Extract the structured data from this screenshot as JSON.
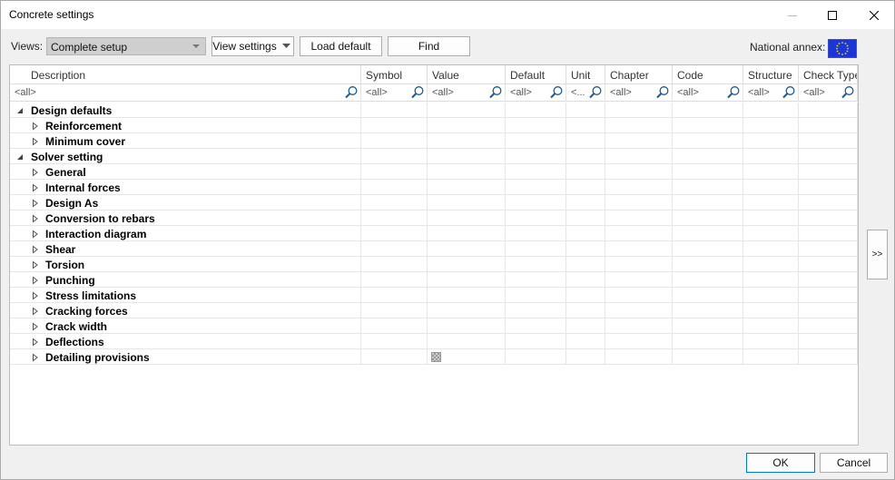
{
  "window": {
    "title": "Concrete settings"
  },
  "toolbar": {
    "views_label": "Views:",
    "views_value": "Complete setup",
    "view_settings_label": "View settings",
    "load_default_label": "Load default",
    "find_label": "Find",
    "national_annex_label": "National annex:"
  },
  "grid": {
    "columns": [
      "Description",
      "Symbol",
      "Value",
      "Default",
      "Unit",
      "Chapter",
      "Code",
      "Structure",
      "Check Type"
    ],
    "filters": [
      "<all>",
      "<all>",
      "<all>",
      "<all>",
      "<...",
      "<all>",
      "<all>",
      "<all>",
      "<all>"
    ],
    "rows": [
      {
        "label": "Design defaults",
        "level": 0,
        "expanded": true
      },
      {
        "label": "Reinforcement",
        "level": 1,
        "expanded": false
      },
      {
        "label": "Minimum cover",
        "level": 1,
        "expanded": false
      },
      {
        "label": "Solver setting",
        "level": 0,
        "expanded": true
      },
      {
        "label": "General",
        "level": 1,
        "expanded": false
      },
      {
        "label": "Internal forces",
        "level": 1,
        "expanded": false
      },
      {
        "label": "Design As",
        "level": 1,
        "expanded": false
      },
      {
        "label": "Conversion to rebars",
        "level": 1,
        "expanded": false
      },
      {
        "label": "Interaction diagram",
        "level": 1,
        "expanded": false
      },
      {
        "label": "Shear",
        "level": 1,
        "expanded": false
      },
      {
        "label": "Torsion",
        "level": 1,
        "expanded": false
      },
      {
        "label": "Punching",
        "level": 1,
        "expanded": false
      },
      {
        "label": "Stress limitations",
        "level": 1,
        "expanded": false
      },
      {
        "label": "Cracking forces",
        "level": 1,
        "expanded": false
      },
      {
        "label": "Crack width",
        "level": 1,
        "expanded": false
      },
      {
        "label": "Deflections",
        "level": 1,
        "expanded": false
      },
      {
        "label": "Detailing provisions",
        "level": 1,
        "expanded": false
      }
    ]
  },
  "side_button_label": ">>",
  "footer": {
    "ok_label": "OK",
    "cancel_label": "Cancel"
  },
  "icons": {
    "minimize": "minimize-icon",
    "maximize": "maximize-icon",
    "close": "close-icon",
    "filter": "magnifier-icon",
    "flag": "eu-flag-icon"
  }
}
